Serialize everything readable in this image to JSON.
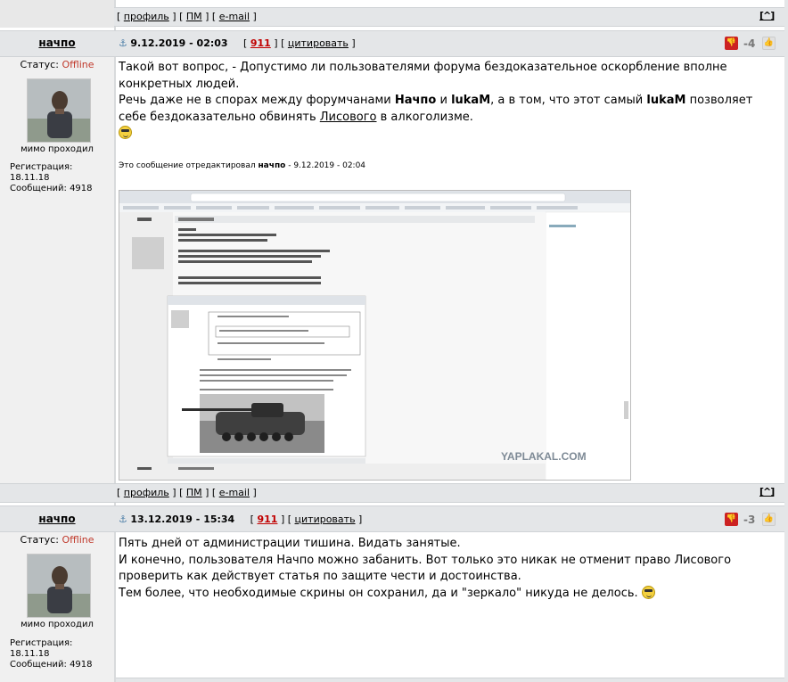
{
  "links": {
    "profile": "профиль",
    "pm": "ПМ",
    "email": "e-mail",
    "up": "[^]"
  },
  "posts": [
    {
      "author": "начпо",
      "status_label": "Статус:",
      "status_value": "Offline",
      "user_title": "мимо проходил",
      "reg_label": "Регистрация:",
      "reg_date": "18.11.18",
      "posts_label": "Сообщений:",
      "posts_count": "4918",
      "anchor_icon": "anchor-icon",
      "date": "9.12.2019 - 02:03",
      "post_number": "911",
      "quote": "цитировать",
      "rating": "-4",
      "paragraph1": "Такой вот вопрос, - Допустимо ли пользователями форума бездоказательное оскорбление вполне конкретных людей.",
      "paragraph2_a": "Речь даже не в спорах между форумчанами ",
      "paragraph2_name1": "Начпо",
      "paragraph2_and": " и ",
      "paragraph2_name2": "lukaM",
      "paragraph2_b": ", а в том, что этот самый ",
      "paragraph2_name3": "lukaM",
      "paragraph2_c": " позволяет себе бездоказательно обвинять ",
      "paragraph2_link": "Лисового",
      "paragraph2_d": " в алкоголизме.",
      "edited_prefix": "Это сообщение отредактировал ",
      "edited_author": "начпо",
      "edited_date": " - 9.12.2019 - 02:04",
      "screenshot_watermark": "YAPLAKAL.COM"
    },
    {
      "author": "начпо",
      "status_label": "Статус:",
      "status_value": "Offline",
      "user_title": "мимо проходил",
      "reg_label": "Регистрация:",
      "reg_date": "18.11.18",
      "posts_label": "Сообщений:",
      "posts_count": "4918",
      "date": "13.12.2019 - 15:34",
      "post_number": "911",
      "quote": "цитировать",
      "rating": "-3",
      "line1": "Пять дней от администрации тишина. Видать занятые.",
      "line2": "И конечно, пользователя Начпо можно забанить. Вот только это никак не отменит право Лисового проверить как действует статья по защите чести и достоинства.",
      "line3": "Тем более, что необходимые скрины он сохранил, да и \"зеркало\" никуда не делось."
    }
  ]
}
